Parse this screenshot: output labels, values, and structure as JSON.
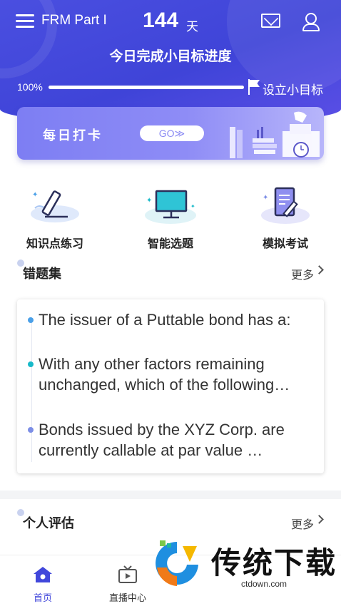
{
  "header": {
    "app_title": "FRM Part I",
    "days_count": "144",
    "days_unit": "天",
    "goal_title": "今日完成小目标进度",
    "progress_label": "100%",
    "progress_value": 1.0,
    "set_goal_label": "设立小目标",
    "bg_color": "#4147db"
  },
  "banner": {
    "text": "每日打卡",
    "go_label": "GO≫"
  },
  "features": [
    {
      "label": "知识点练习",
      "icon": "pen-icon"
    },
    {
      "label": "智能选题",
      "icon": "monitor-icon"
    },
    {
      "label": "模拟考试",
      "icon": "exam-paper-icon"
    }
  ],
  "wrong_questions": {
    "title": "错题集",
    "more_label": "更多",
    "items": [
      {
        "text": "The issuer of a Puttable bond has a:",
        "bullet_color": "#4aa0e8"
      },
      {
        "text": "With any other factors remaining unchanged, which of the following…",
        "bullet_color": "#17b9c9"
      },
      {
        "text": "Bonds issued by the XYZ Corp. are currently callable at par value …",
        "bullet_color": "#7c8ee6"
      }
    ]
  },
  "personal_eval": {
    "title": "个人评估",
    "more_label": "更多"
  },
  "bottom_nav": {
    "items": [
      {
        "label": "首页",
        "icon": "home-icon",
        "active": true
      },
      {
        "label": "直播中心",
        "icon": "tv-icon",
        "active": false
      }
    ],
    "active_color": "#4147db"
  },
  "watermark": {
    "text": "传统下载",
    "url": "ctdown.com"
  }
}
